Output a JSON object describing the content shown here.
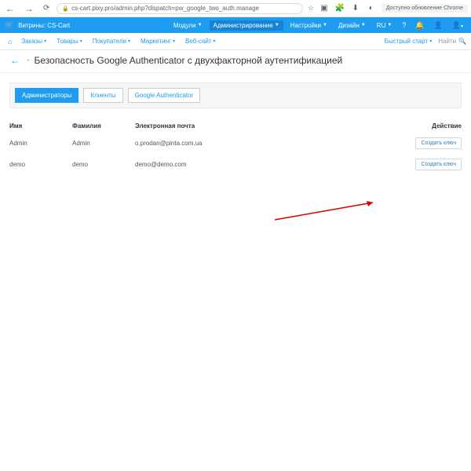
{
  "browser": {
    "url": "cs-cart.pixy.pro/admin.php?dispatch=pw_google_two_auth.manage",
    "update_text": "Доступно обновление Chrome"
  },
  "topbar": {
    "storefront": "Витрины: CS-Cart",
    "menu": {
      "modules": "Модули",
      "admin": "Администрирование",
      "settings": "Настройки",
      "design": "Дизайн",
      "lang": "RU"
    }
  },
  "navbar": {
    "items": [
      "Заказы",
      "Товары",
      "Покупатели",
      "Маркетинг",
      "Веб-сайт"
    ],
    "quickstart": "Быстрый старт",
    "search_placeholder": "Найти"
  },
  "page": {
    "title": "Безопасность Google Authenticator с двухфакторной аутентификацией"
  },
  "tabs": {
    "admins": "Администраторы",
    "clients": "Клиенты",
    "ga": "Google Authenticator"
  },
  "table": {
    "headers": {
      "fn": "Имя",
      "ln": "Фамилия",
      "em": "Электронная почта",
      "ac": "Действие"
    },
    "rows": [
      {
        "fn": "Admin",
        "ln": "Admin",
        "em": "o.prodan@pinta.com.ua",
        "btn": "Создать ключ"
      },
      {
        "fn": "demo",
        "ln": "demo",
        "em": "demo@demo.com",
        "btn": "Создать ключ"
      }
    ]
  }
}
